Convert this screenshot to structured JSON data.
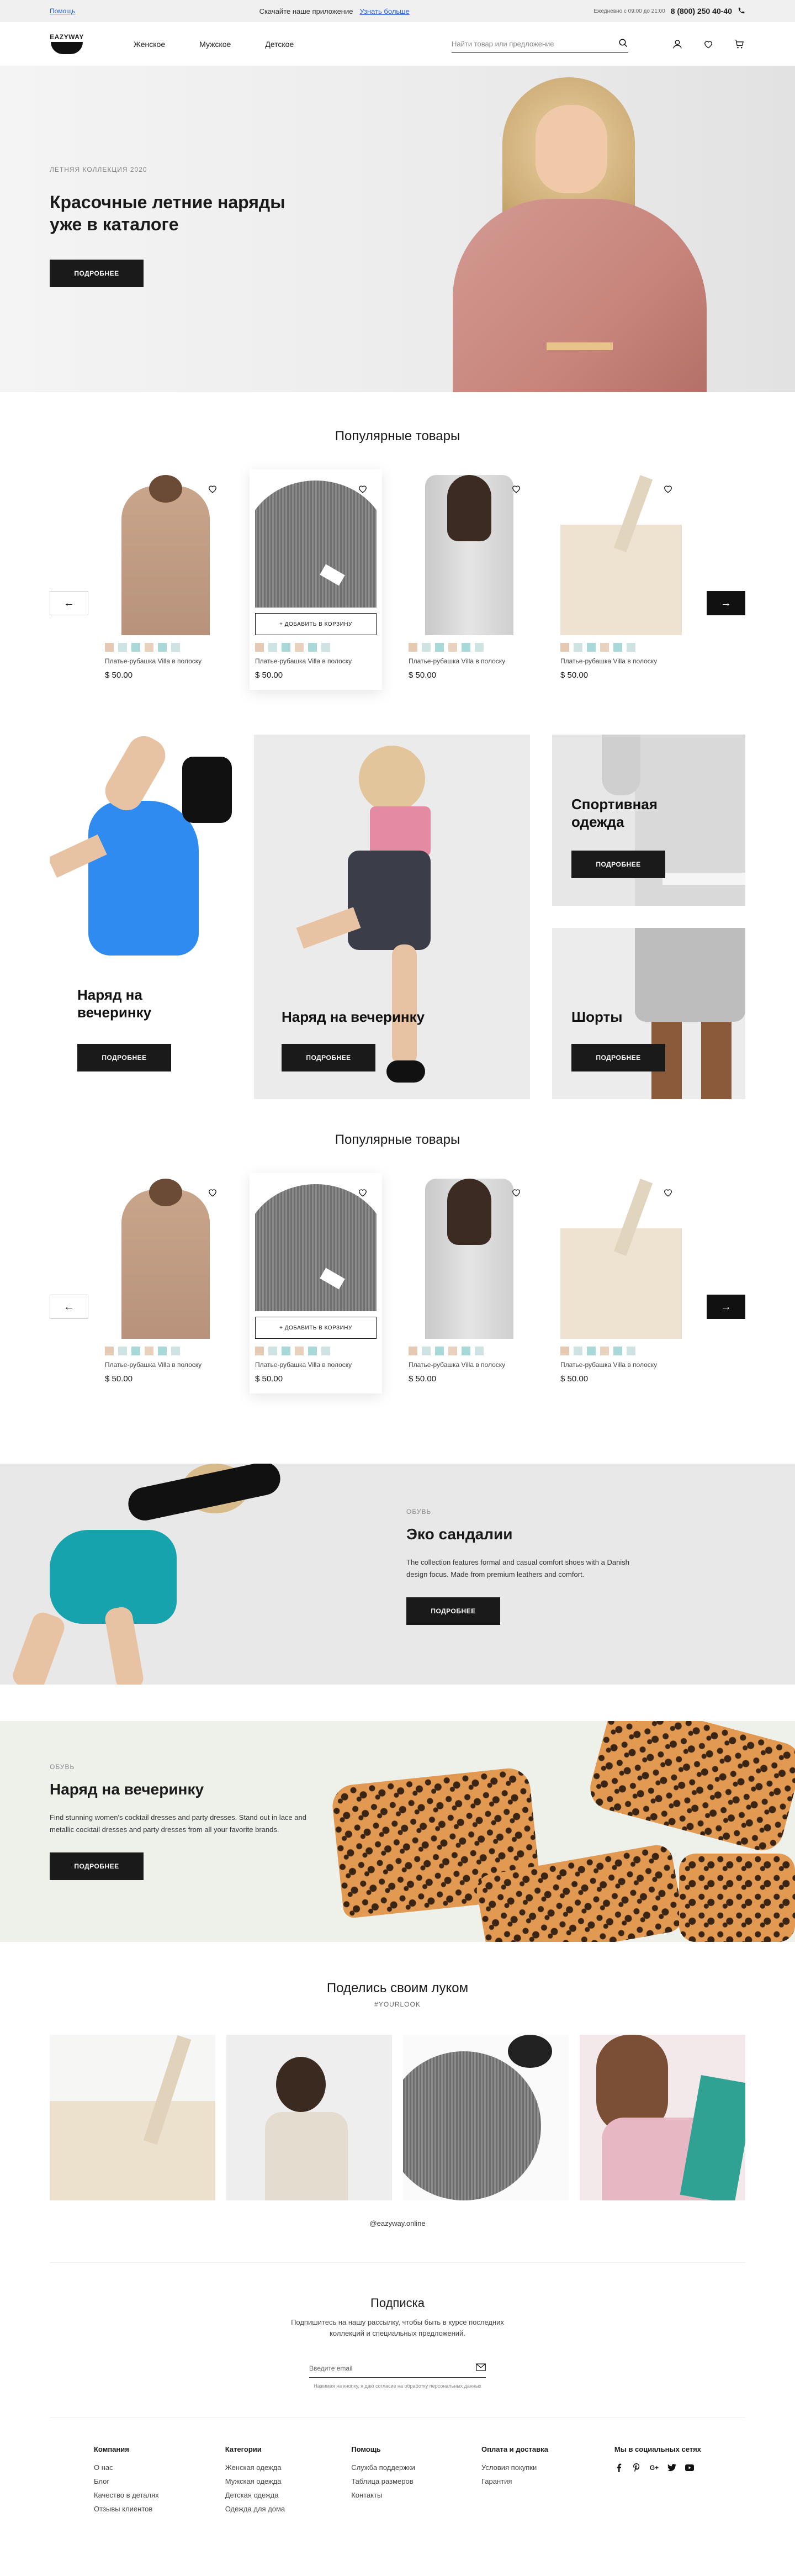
{
  "topbar": {
    "help": "Помощь",
    "app_text": "Скачайте наше приложение",
    "app_link": "Узнать больше",
    "hours": "Ежедневно с 09:00 до 21:00",
    "phone": "8 (800) 250 40-40"
  },
  "header": {
    "logo": "EAZYWAY",
    "nav": [
      "Женское",
      "Мужское",
      "Детское"
    ],
    "search_placeholder": "Найти товар или предложение"
  },
  "hero": {
    "eyebrow": "ЛЕТНЯЯ КОЛЛЕКЦИЯ 2020",
    "title": "Красочные летние наряды уже в каталоге",
    "button": "ПОДРОБНЕЕ"
  },
  "popular": {
    "title": "Популярные товары",
    "add_to_cart": "+ ДОБАВИТЬ В КОРЗИНУ",
    "products": [
      {
        "name": "Платье-рубашка Villa в полоску",
        "price": "$ 50.00"
      },
      {
        "name": "Платье-рубашка Villa в полоску",
        "price": "$ 50.00"
      },
      {
        "name": "Платье-рубашка Villa в полоску",
        "price": "$ 50.00"
      },
      {
        "name": "Платье-рубашка Villa в полоску",
        "price": "$ 50.00"
      }
    ],
    "swatch_colors": [
      "#e6c9b3",
      "#cfe3e3",
      "#a8d8d8",
      "#e8d2bd",
      "#a8d8d8",
      "#cfe3e3"
    ]
  },
  "categories": {
    "party1": "Наряд на вечеринку",
    "party2": "Наряд на вечеринку",
    "sport": "Спортивная одежда",
    "shorts": "Шорты",
    "button": "ПОДРОБНЕЕ"
  },
  "eco": {
    "eyebrow": "ОБУВЬ",
    "title": "Эко сандалии",
    "text": "The collection features formal and casual comfort shoes with a Danish design focus. Made from premium leathers and comfort.",
    "button": "ПОДРОБНЕЕ"
  },
  "party": {
    "eyebrow": "ОБУВЬ",
    "title": "Наряд на вечеринку",
    "text": "Find stunning women's cocktail dresses and party dresses. Stand out in lace and metallic cocktail dresses and party dresses from all your favorite brands.",
    "button": "ПОДРОБНЕЕ"
  },
  "share": {
    "title": "Поделись своим луком",
    "tag": "#YOURLOOK",
    "handle": "@eazyway.online"
  },
  "subscribe": {
    "title": "Подписка",
    "text": "Подпишитесь на нашу рассылку, чтобы быть в курсе последних коллекций и специальных предложений.",
    "placeholder": "Введите email",
    "consent": "Нажимая на кнопку, я даю согласие на обработку персональных данных"
  },
  "footer": {
    "company": {
      "title": "Компания",
      "links": [
        "О нас",
        "Блог",
        "Качество в деталях",
        "Отзывы клиентов"
      ]
    },
    "categories": {
      "title": "Категории",
      "links": [
        "Женская одежда",
        "Мужская одежда",
        "Детская одежда",
        "Одежда для дома"
      ]
    },
    "help": {
      "title": "Помощь",
      "links": [
        "Служба поддержки",
        "Таблица размеров",
        "Контакты"
      ]
    },
    "delivery": {
      "title": "Оплата и доставка",
      "links": [
        "Условия покупки",
        "Гарантия"
      ]
    },
    "social": {
      "title": "Мы в социальных сетях",
      "icons": [
        "facebook-icon",
        "pinterest-icon",
        "google-plus-icon",
        "twitter-icon",
        "youtube-icon"
      ]
    }
  }
}
